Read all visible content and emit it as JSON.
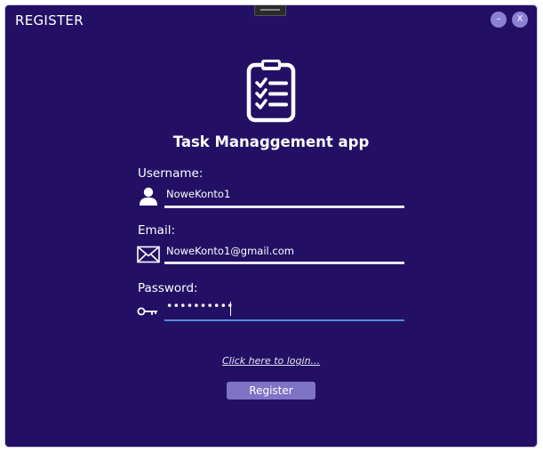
{
  "window": {
    "title": "REGISTER",
    "minimize_label": "–",
    "close_label": "X"
  },
  "app": {
    "title": "Task Managgement app",
    "logo_icon": "clipboard-checklist-icon"
  },
  "form": {
    "username": {
      "label": "Username:",
      "value": "NoweKonto1",
      "icon": "user-icon"
    },
    "email": {
      "label": "Email:",
      "value": "NoweKonto1@gmail.com",
      "icon": "envelope-icon"
    },
    "password": {
      "label": "Password:",
      "value": "••••••••••",
      "icon": "key-icon"
    }
  },
  "actions": {
    "login_link": "Click here to login...",
    "register_label": "Register"
  },
  "colors": {
    "background": "#231065",
    "accent": "#7e73c4",
    "focus_underline": "#4f8fd6"
  }
}
